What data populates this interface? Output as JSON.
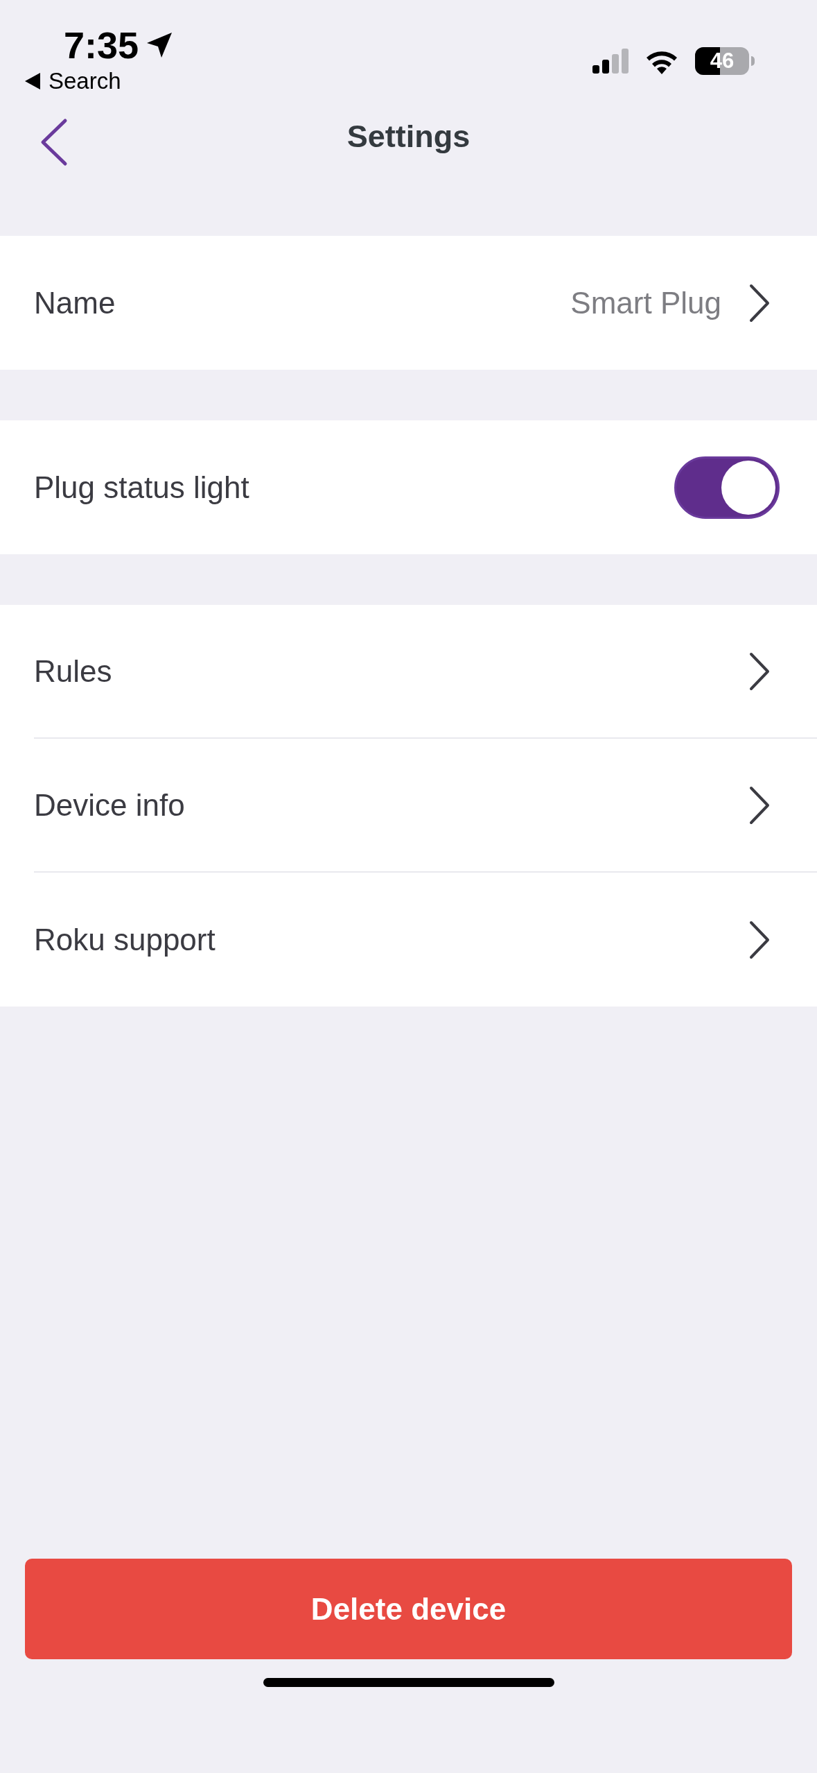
{
  "status_bar": {
    "time": "7:35",
    "back_label": "Search",
    "battery": "46"
  },
  "nav": {
    "title": "Settings"
  },
  "groups": [
    {
      "rows": [
        {
          "kind": "link",
          "label": "Name",
          "value": "Smart Plug"
        }
      ]
    },
    {
      "rows": [
        {
          "kind": "toggle",
          "label": "Plug status light",
          "on": true
        }
      ]
    },
    {
      "rows": [
        {
          "kind": "link",
          "label": "Rules"
        },
        {
          "kind": "link",
          "label": "Device info"
        },
        {
          "kind": "link",
          "label": "Roku support"
        }
      ]
    }
  ],
  "delete_button": "Delete device"
}
